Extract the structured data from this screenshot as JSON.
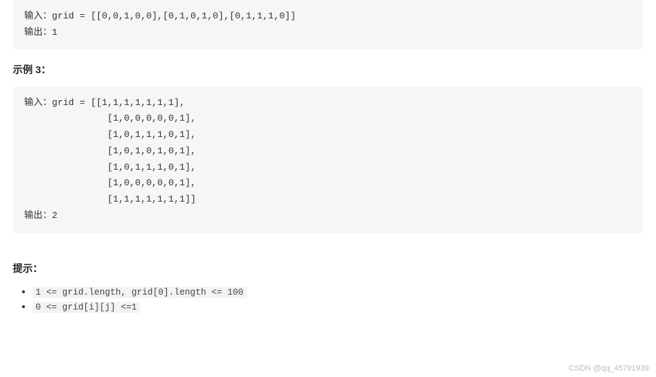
{
  "example2": {
    "input_label": "输入：",
    "input_code": "grid = [[0,0,1,0,0],[0,1,0,1,0],[0,1,1,1,0]]",
    "output_label": "输出：",
    "output_value": "1"
  },
  "example3_heading": "示例 3：",
  "example3": {
    "input_label": "输入：",
    "input_code": "grid = [[1,1,1,1,1,1,1],\n               [1,0,0,0,0,0,1],\n               [1,0,1,1,1,0,1],\n               [1,0,1,0,1,0,1],\n               [1,0,1,1,1,0,1],\n               [1,0,0,0,0,0,1],\n               [1,1,1,1,1,1,1]]",
    "output_label": "输出：",
    "output_value": "2"
  },
  "hints_heading": "提示：",
  "hints": {
    "item1": "1 <= grid.length, grid[0].length <= 100",
    "item2": "0 <= grid[i][j] <=1"
  },
  "watermark": "CSDN @qq_45791939"
}
